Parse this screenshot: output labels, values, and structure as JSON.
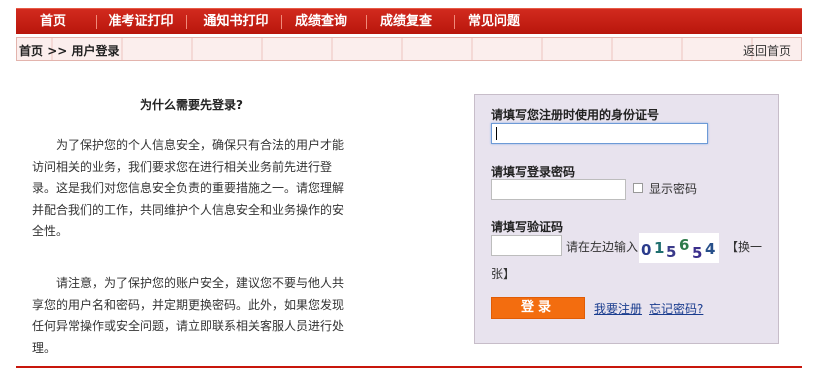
{
  "nav": {
    "items": [
      "首页",
      "准考证打印",
      "通知书打印",
      "成绩查询",
      "成绩复查",
      "常见问题"
    ]
  },
  "breadcrumb": {
    "home": "首页",
    "separator": ">>",
    "current": "用户登录",
    "back": "返回首页"
  },
  "info": {
    "title": "为什么需要先登录?",
    "para1": "为了保护您的个人信息安全，确保只有合法的用户才能访问相关的业务，我们要求您在进行相关业务前先进行登录。这是我们对您信息安全负责的重要措施之一。请您理解并配合我们的工作，共同维护个人信息安全和业务操作的安全性。",
    "para2": "请注意，为了保护您的账户安全，建议您不要与他人共享您的用户名和密码，并定期更换密码。此外，如果您发现任何异常操作或安全问题，请立即联系相关客服人员进行处理。"
  },
  "form": {
    "id_label": "请填写您注册时使用的身份证号",
    "id_value": "",
    "password_label": "请填写登录密码",
    "password_value": "",
    "show_password": "显示密码",
    "captcha_label": "请填写验证码",
    "captcha_value": "",
    "captcha_hint": "请在左边输入",
    "captcha_chars": [
      "0",
      "1",
      "5",
      "6",
      "5",
      "4"
    ],
    "refresh_text": "【换一",
    "refresh_tail": "张】",
    "login_button": "登录",
    "register_link": "我要注册",
    "forgot_link": "忘记密码?"
  },
  "colors": {
    "nav_red": "#c41d12",
    "button_orange": "#f36d0f",
    "panel_bg": "#e8e3ee",
    "link_blue": "#1a3d8f"
  }
}
